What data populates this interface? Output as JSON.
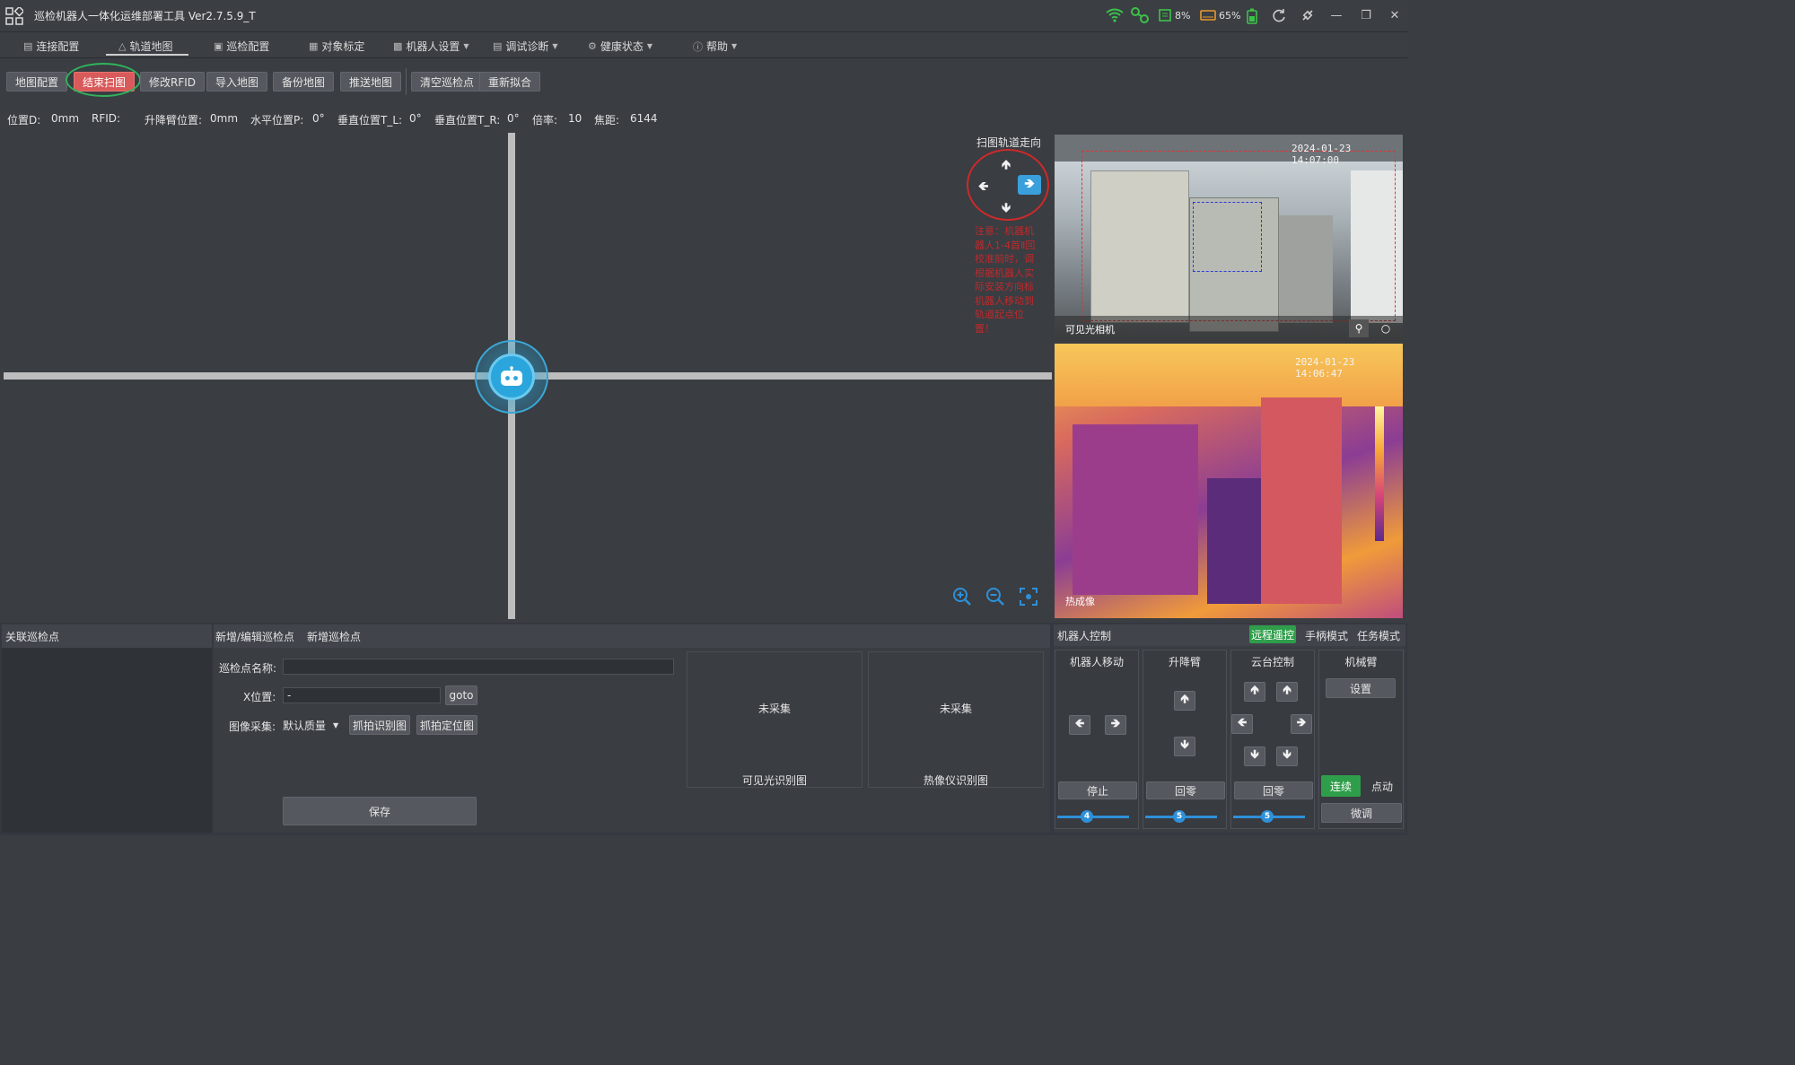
{
  "app": {
    "title": "巡检机器人一体化运维部署工具  Ver2.7.5.9_T"
  },
  "status_icons": {
    "cpu": "8%",
    "disk": "65%"
  },
  "menu": [
    {
      "label": "连接配置",
      "icon": "connect-icon"
    },
    {
      "label": "轨道地图",
      "icon": "map-icon"
    },
    {
      "label": "巡检配置",
      "icon": "inspect-icon"
    },
    {
      "label": "对象标定",
      "icon": "target-icon"
    },
    {
      "label": "机器人设置",
      "icon": "robot-icon"
    },
    {
      "label": "调试诊断",
      "icon": "debug-icon"
    },
    {
      "label": "健康状态",
      "icon": "health-icon"
    },
    {
      "label": "帮助",
      "icon": "help-icon"
    }
  ],
  "toolbar": {
    "map_config": "地图配置",
    "end_scan": "结束扫图",
    "edit_rfid": "修改RFID",
    "import_map": "导入地图",
    "backup_map": "备份地图",
    "push_map": "推送地图",
    "clear_points": "清空巡检点",
    "refit": "重新拟合"
  },
  "status": {
    "pos_d_label": "位置D:",
    "pos_d_value": "0mm",
    "rfid_label": "RFID:",
    "rfid_value": "",
    "lift_label": "升降臂位置:",
    "lift_value": "0mm",
    "hpos_label": "水平位置P:",
    "hpos_value": "0°",
    "vposl_label": "垂直位置T_L:",
    "vposl_value": "0°",
    "vposr_label": "垂直位置T_R:",
    "vposr_value": "0°",
    "zoom_label": "倍率:",
    "zoom_value": "10",
    "focus_label": "焦距:",
    "focus_value": "6144"
  },
  "map": {
    "direction_title": "扫图轨道走向",
    "note": "注意：机器机器人1-4首Ⅱ回校准前时，调根据机器人实际安装方向标机器人移动到轨道起点位置！"
  },
  "cameras": {
    "visible_ts": "2024-01-23 14:07:00",
    "visible_label": "可见光相机",
    "thermal_ts": "2024-01-23 14:06:47",
    "thermal_label": "热成像"
  },
  "assoc": {
    "title": "关联巡检点"
  },
  "edit": {
    "tab_edit": "新增/编辑巡检点",
    "tab_new": "新增巡检点",
    "name_label": "巡检点名称:",
    "name_value": "",
    "x_label": "X位置:",
    "x_value": "-",
    "goto": "goto",
    "img_label": "图像采集:",
    "quality": "默认质量",
    "capture_recog": "抓拍识别图",
    "capture_locate": "抓拍定位图",
    "save": "保存",
    "visible_status": "未采集",
    "visible_caption": "可见光识别图",
    "thermal_status": "未采集",
    "thermal_caption": "热像仪识别图"
  },
  "control": {
    "title": "机器人控制",
    "mode_remote": "远程遥控",
    "mode_manual": "手柄模式",
    "mode_task": "任务模式",
    "col_move": "机器人移动",
    "col_lift": "升降臂",
    "col_ptz": "云台控制",
    "col_arm": "机械臂",
    "stop": "停止",
    "lift_zero": "回零",
    "ptz_zero": "回零",
    "arm_setting": "设置",
    "continuous": "连续",
    "point": "点动",
    "fine": "微调",
    "speed_move": "4",
    "speed_lift": "5",
    "speed_ptz": "5"
  },
  "colors": {
    "accent": "#2aa6dd",
    "danger": "#d95a5a",
    "note_red": "#c0292b",
    "active_green": "#2f9e4a"
  }
}
